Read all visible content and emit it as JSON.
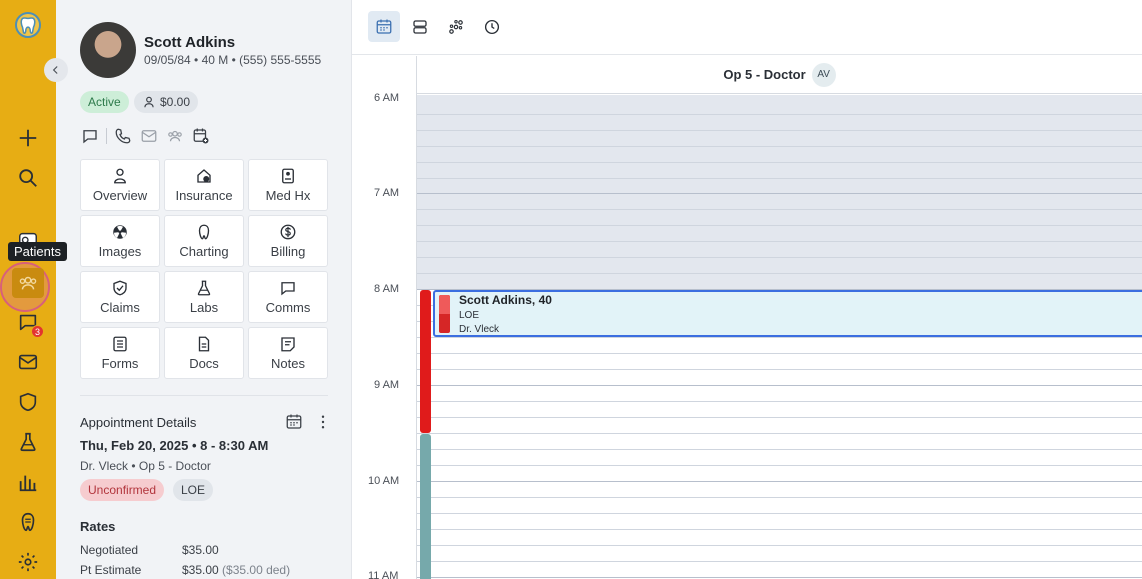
{
  "rail": {
    "tooltip": "Patients",
    "messages_badge": "3",
    "items": [
      "logo-icon",
      "plus-icon",
      "search-icon",
      "schedule-icon",
      "patients-icon",
      "messages-icon",
      "mail-icon",
      "shield-icon",
      "labs-icon",
      "reports-icon",
      "tooth-icon",
      "settings-icon"
    ]
  },
  "patient": {
    "name": "Scott Adkins",
    "info": "09/05/84 • 40 M • (555) 555-5555",
    "status": "Active",
    "balance": "$0.00"
  },
  "tiles": [
    {
      "label": "Overview",
      "icon": "person-icon"
    },
    {
      "label": "Insurance",
      "icon": "insurance-icon"
    },
    {
      "label": "Med Hx",
      "icon": "medhx-icon"
    },
    {
      "label": "Images",
      "icon": "radiation-icon"
    },
    {
      "label": "Charting",
      "icon": "tooth-icon"
    },
    {
      "label": "Billing",
      "icon": "dollar-icon"
    },
    {
      "label": "Claims",
      "icon": "shield-check-icon"
    },
    {
      "label": "Labs",
      "icon": "flask-icon"
    },
    {
      "label": "Comms",
      "icon": "chat-icon"
    },
    {
      "label": "Forms",
      "icon": "form-icon"
    },
    {
      "label": "Docs",
      "icon": "doc-icon"
    },
    {
      "label": "Notes",
      "icon": "note-icon"
    }
  ],
  "appointment": {
    "title": "Appointment Details",
    "date": "Thu, Feb 20, 2025 • 8 - 8:30 AM",
    "provider": "Dr. Vleck • Op 5 - Doctor",
    "status": "Unconfirmed",
    "type": "LOE"
  },
  "rates": {
    "title": "Rates",
    "rows": [
      {
        "label": "Negotiated",
        "value": "$35.00",
        "extra": ""
      },
      {
        "label": "Pt Estimate",
        "value": "$35.00",
        "extra": "($35.00 ded)"
      }
    ]
  },
  "calendar": {
    "column": "Op 5 - Doctor",
    "column_avatar": "AV",
    "times": [
      "6 AM",
      "7 AM",
      "8 AM",
      "9 AM",
      "10 AM",
      "11 AM"
    ],
    "event": {
      "title": "Scott Adkins, 40",
      "type": "LOE",
      "provider": "Dr. Vleck"
    }
  },
  "colors": {
    "rail": "#e7ad14",
    "event_border": "#3b6ee0",
    "event_bg": "#e2f3f8",
    "unconfirmed": "#e01b1b"
  }
}
